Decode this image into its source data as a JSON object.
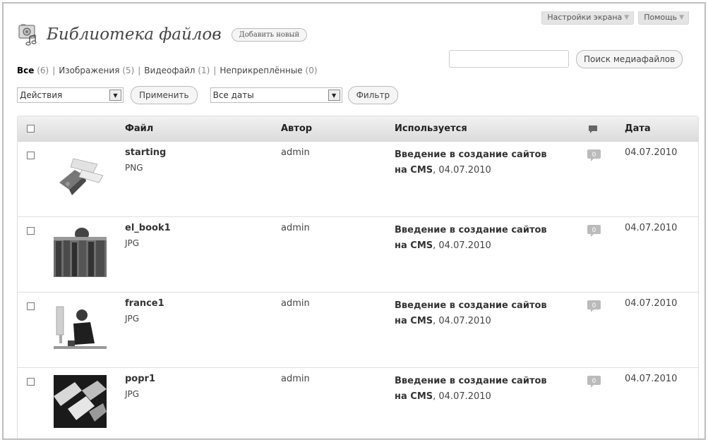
{
  "screen_meta": {
    "options_label": "Настройки экрана",
    "help_label": "Помощь"
  },
  "header": {
    "title": "Библиотека файлов",
    "add_new_label": "Добавить новый"
  },
  "filters": {
    "all_label": "Все",
    "all_count": "(6)",
    "images_label": "Изображения",
    "images_count": "(5)",
    "video_label": "Видеофайл",
    "video_count": "(1)",
    "unattached_label": "Неприкреплённые",
    "unattached_count": "(0)"
  },
  "search": {
    "value": "",
    "button_label": "Поиск медиафайлов"
  },
  "bulk": {
    "action_value": "Действия",
    "apply_label": "Применить",
    "date_value": "Все даты",
    "filter_label": "Фильтр"
  },
  "table": {
    "headers": {
      "file": "Файл",
      "author": "Автор",
      "attached": "Используется",
      "date": "Дата"
    },
    "rows": [
      {
        "name": "starting",
        "type": "PNG",
        "author": "admin",
        "attached_title": "Введение в создание сайтов",
        "attached_rest": "на CMS",
        "attached_date": "04.07.2010",
        "comments": "0",
        "date": "04.07.2010"
      },
      {
        "name": "el_book1",
        "type": "JPG",
        "author": "admin",
        "attached_title": "Введение в создание сайтов",
        "attached_rest": "на CMS",
        "attached_date": "04.07.2010",
        "comments": "0",
        "date": "04.07.2010"
      },
      {
        "name": "france1",
        "type": "JPG",
        "author": "admin",
        "attached_title": "Введение в создание сайтов",
        "attached_rest": "на CMS",
        "attached_date": "04.07.2010",
        "comments": "0",
        "date": "04.07.2010"
      },
      {
        "name": "popr1",
        "type": "JPG",
        "author": "admin",
        "attached_title": "Введение в создание сайтов",
        "attached_rest": "на CMS",
        "attached_date": "04.07.2010",
        "comments": "0",
        "date": "04.07.2010"
      }
    ]
  }
}
